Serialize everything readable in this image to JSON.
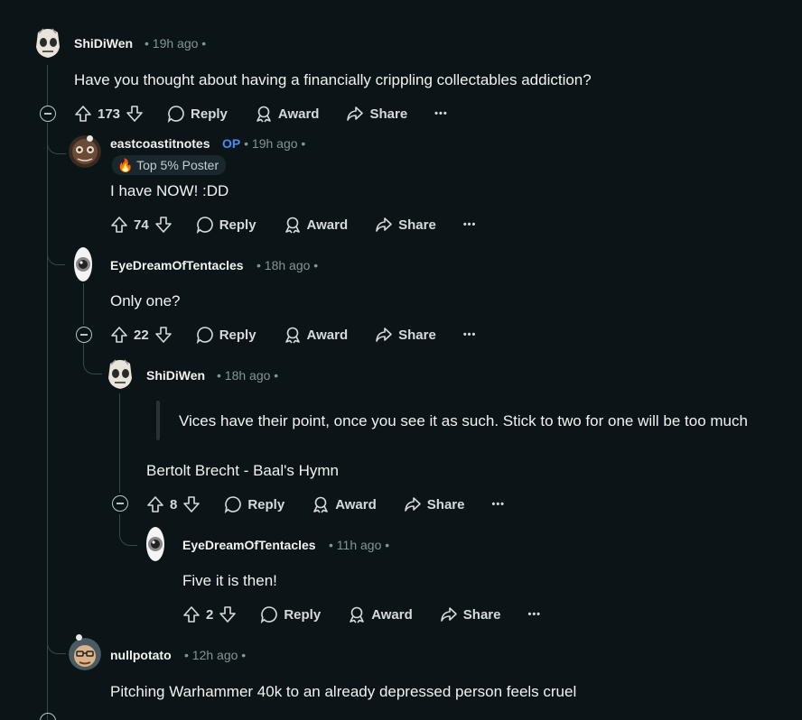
{
  "comments": [
    {
      "username": "ShiDiWen",
      "time": "19h ago",
      "text": "Have you thought about having a financially crippling collectables addiction?",
      "votes": "173",
      "reply": "Reply",
      "award": "Award",
      "share": "Share",
      "more": "•••"
    },
    {
      "username": "eastcoastitnotes",
      "op_badge": "OP",
      "time": "19h ago",
      "flair": "Top 5% Poster",
      "text": "I have NOW! :DD",
      "votes": "74",
      "reply": "Reply",
      "award": "Award",
      "share": "Share",
      "more": "•••"
    },
    {
      "username": "EyeDreamOfTentacles",
      "time": "18h ago",
      "text": "Only one?",
      "votes": "22",
      "reply": "Reply",
      "award": "Award",
      "share": "Share",
      "more": "•••"
    },
    {
      "username": "ShiDiWen",
      "time": "18h ago",
      "quote": "Vices have their point, once you see it as such. Stick to two for one will be too much",
      "text": "Bertolt Brecht - Baal's Hymn",
      "votes": "8",
      "reply": "Reply",
      "award": "Award",
      "share": "Share",
      "more": "•••"
    },
    {
      "username": "EyeDreamOfTentacles",
      "time": "11h ago",
      "text": "Five it is then!",
      "votes": "2",
      "reply": "Reply",
      "award": "Award",
      "share": "Share",
      "more": "•••"
    },
    {
      "username": "nullpotato",
      "time": "12h ago",
      "text": "Pitching Warhammer 40k to an already depressed person feels cruel"
    }
  ],
  "separator": "•",
  "icons": [
    "upvote-icon",
    "downvote-icon",
    "reply-bubble-icon",
    "award-icon",
    "share-icon",
    "collapse-icon",
    "more-icon"
  ]
}
